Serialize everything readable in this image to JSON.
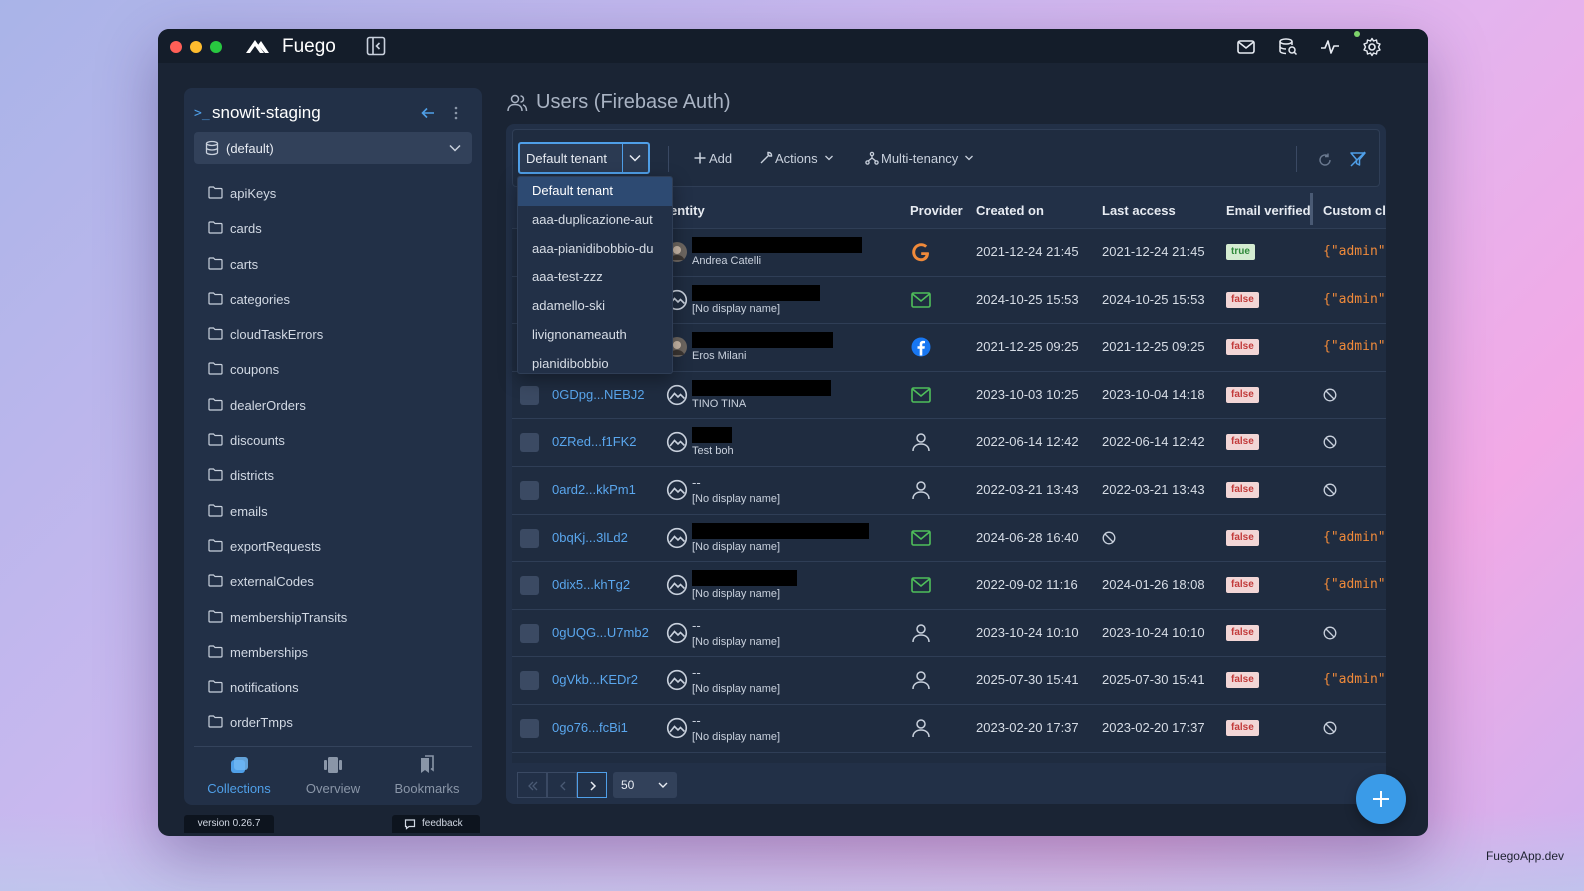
{
  "app": {
    "name": "Fuego"
  },
  "sidebar": {
    "project": "snowit-staging",
    "database": "(default)",
    "collections": [
      "apiKeys",
      "cards",
      "carts",
      "categories",
      "cloudTaskErrors",
      "coupons",
      "dealerOrders",
      "discounts",
      "districts",
      "emails",
      "exportRequests",
      "externalCodes",
      "membershipTransits",
      "memberships",
      "notifications",
      "orderTmps"
    ],
    "tabs": [
      {
        "label": "Collections",
        "icon": "collections-icon",
        "active": true
      },
      {
        "label": "Overview",
        "icon": "overview-icon",
        "active": false
      },
      {
        "label": "Bookmarks",
        "icon": "bookmarks-icon",
        "active": false
      }
    ],
    "version": "version 0.26.7",
    "feedback": "feedback"
  },
  "main": {
    "title": "Users (Firebase Auth)",
    "tenant_select": "Default tenant",
    "toolbar": {
      "add": "Add",
      "actions": "Actions",
      "multi_tenancy": "Multi-tenancy"
    },
    "columns": {
      "identity": "entity",
      "provider": "Provider",
      "created": "Created on",
      "last_access": "Last access",
      "email_verified": "Email verified",
      "claims": "Custom cl"
    },
    "rows": [
      {
        "uid": "",
        "display_name": "Andrea Catelli",
        "avatar": "photo",
        "provider": "google-icon",
        "created": "2021-12-24 21:45",
        "last_access": "2021-12-24 21:45",
        "verified": "true",
        "claims": "{\"admin\""
      },
      {
        "uid": "",
        "display_name": "[No display name]",
        "avatar": "placeholder",
        "provider": "email-icon",
        "created": "2024-10-25 15:53",
        "last_access": "2024-10-25 15:53",
        "verified": "false",
        "claims": "{\"admin\""
      },
      {
        "uid": "",
        "display_name": "Eros Milani",
        "avatar": "photo",
        "provider": "facebook-icon",
        "created": "2021-12-25 09:25",
        "last_access": "2021-12-25 09:25",
        "verified": "false",
        "claims": "{\"admin\""
      },
      {
        "uid": "0GDpg...NEBJ2",
        "display_name": "TINO TINA",
        "avatar": "placeholder",
        "provider": "email-icon",
        "created": "2023-10-03 10:25",
        "last_access": "2023-10-04 14:18",
        "verified": "false",
        "claims": ""
      },
      {
        "uid": "0ZRed...f1FK2",
        "display_name": "Test boh",
        "avatar": "placeholder",
        "provider": "user-icon",
        "created": "2022-06-14 12:42",
        "last_access": "2022-06-14 12:42",
        "verified": "false",
        "claims": ""
      },
      {
        "uid": "0ard2...kkPm1",
        "display_name": "[No display name]",
        "email": "--",
        "avatar": "placeholder",
        "provider": "user-icon",
        "created": "2022-03-21 13:43",
        "last_access": "2022-03-21 13:43",
        "verified": "false",
        "claims": ""
      },
      {
        "uid": "0bqKj...3lLd2",
        "display_name": "[No display name]",
        "avatar": "placeholder",
        "provider": "email-icon",
        "created": "2024-06-28 16:40",
        "last_access": "",
        "verified": "false",
        "claims": "{\"admin\""
      },
      {
        "uid": "0dix5...khTg2",
        "display_name": "[No display name]",
        "avatar": "placeholder",
        "provider": "email-icon",
        "created": "2022-09-02 11:16",
        "last_access": "2024-01-26 18:08",
        "verified": "false",
        "claims": "{\"admin\""
      },
      {
        "uid": "0gUQG...U7mb2",
        "display_name": "[No display name]",
        "email": "--",
        "avatar": "placeholder",
        "provider": "user-icon",
        "created": "2023-10-24 10:10",
        "last_access": "2023-10-24 10:10",
        "verified": "false",
        "claims": ""
      },
      {
        "uid": "0gVkb...KEDr2",
        "display_name": "[No display name]",
        "email": "--",
        "avatar": "placeholder",
        "provider": "user-icon",
        "created": "2025-07-30 15:41",
        "last_access": "2025-07-30 15:41",
        "verified": "false",
        "claims": "{\"admin\""
      },
      {
        "uid": "0go76...fcBi1",
        "display_name": "[No display name]",
        "email": "--",
        "avatar": "placeholder",
        "provider": "user-icon",
        "created": "2023-02-20 17:37",
        "last_access": "2023-02-20 17:37",
        "verified": "false",
        "claims": ""
      },
      {
        "uid": "",
        "display_name": "",
        "email": "--",
        "avatar": "placeholder",
        "provider": "user-icon",
        "created": "",
        "last_access": "",
        "verified": "",
        "claims": ""
      }
    ],
    "tenant_options": [
      "Default tenant",
      "aaa-duplicazione-aut",
      "aaa-pianidibobbio-du",
      "aaa-test-zzz",
      "adamello-ski",
      "livignonameauth",
      "pianidibobbio"
    ],
    "page_size": "50"
  },
  "footer": {
    "brand": "FuegoApp.dev"
  },
  "colors": {
    "accent": "#4f9fe8",
    "claims": "#f08a3a",
    "window": "#1a2434"
  }
}
